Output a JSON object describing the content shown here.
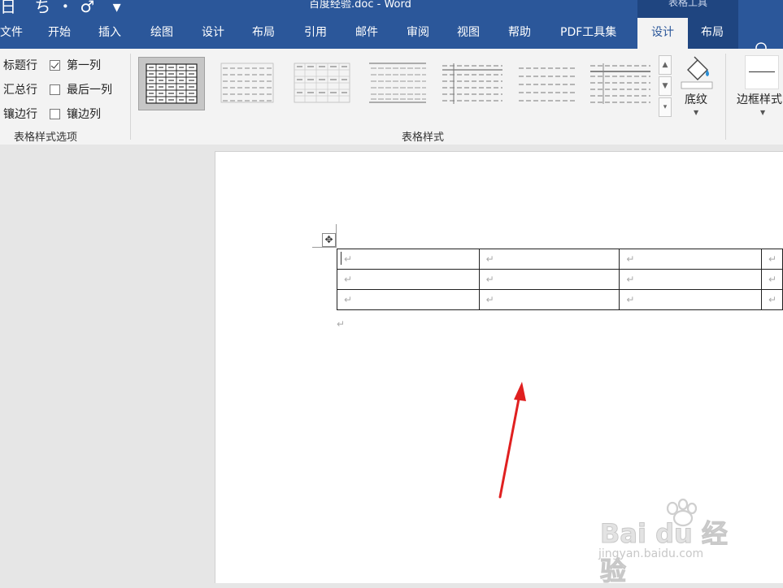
{
  "titlebar": {
    "quick_access": "日 ち・♂ ▾",
    "doc_title": "百度经验.doc  -  Word",
    "context_tab_group": "表格工具"
  },
  "tabs": [
    {
      "label": "文件"
    },
    {
      "label": "开始"
    },
    {
      "label": "插入"
    },
    {
      "label": "绘图"
    },
    {
      "label": "设计"
    },
    {
      "label": "布局"
    },
    {
      "label": "引用"
    },
    {
      "label": "邮件"
    },
    {
      "label": "审阅"
    },
    {
      "label": "视图"
    },
    {
      "label": "帮助"
    },
    {
      "label": "PDF工具集"
    },
    {
      "label": "设计"
    },
    {
      "label": "布局"
    }
  ],
  "table_style_options": {
    "group_label": "表格样式选项",
    "header_row": "标题行",
    "total_row": "汇总行",
    "banded_rows": "镶边行",
    "first_column": "第一列",
    "last_column": "最后一列",
    "banded_columns": "镶边列",
    "first_column_checked": true,
    "last_column_checked": false,
    "banded_columns_checked": false
  },
  "table_styles": {
    "group_label": "表格样式",
    "selected_index": 0
  },
  "shading": {
    "label": "底纹"
  },
  "borders": {
    "label": "边框样式"
  },
  "document": {
    "table_rows": 3,
    "table_cols": 4,
    "cell_mark": "↵",
    "paragraph_mark": "↵"
  },
  "watermark": {
    "brand": "Bai du 经验",
    "url": "jingyan.baidu.com"
  },
  "colors": {
    "ribbon_blue": "#2b579a",
    "context_tab_blue": "#1f4580",
    "arrow_red": "#e02020"
  }
}
